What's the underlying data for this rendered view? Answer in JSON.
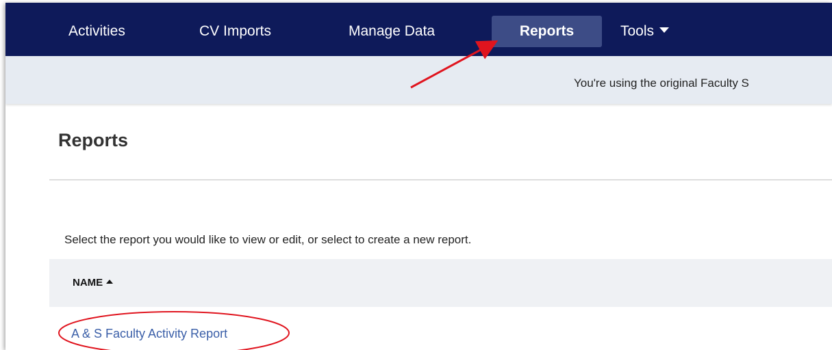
{
  "navbar": {
    "items": [
      {
        "label": "Activities"
      },
      {
        "label": "CV Imports"
      },
      {
        "label": "Manage Data"
      },
      {
        "label": "Reports",
        "active": true
      },
      {
        "label": "Tools",
        "has_dropdown": true
      }
    ]
  },
  "banner": {
    "text": "You're using the original Faculty S"
  },
  "page": {
    "title": "Reports",
    "instructions": "Select the report you would like to view or edit, or select to create a new report."
  },
  "table": {
    "columns": [
      {
        "label": "NAME",
        "sort": "ascending"
      }
    ],
    "rows": [
      {
        "name": "A & S Faculty Activity Report"
      }
    ]
  },
  "colors": {
    "navbar_bg": "#0e1a5a",
    "nav_active_bg": "#3d4c86",
    "banner_bg": "#e6ebf2",
    "table_header_bg": "#eff1f4",
    "link": "#3b5fa8",
    "annotation": "#e0141e"
  }
}
